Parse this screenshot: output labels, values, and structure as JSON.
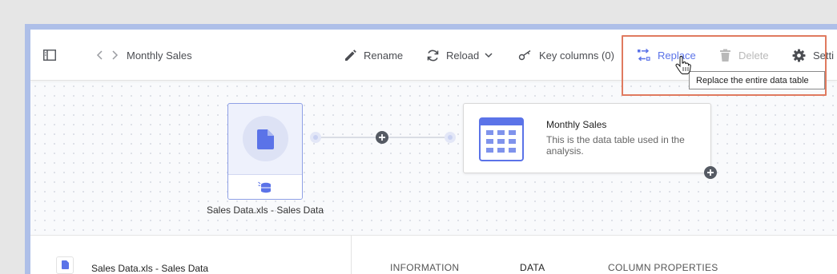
{
  "breadcrumb": {
    "title": "Monthly Sales"
  },
  "toolbar": {
    "rename_label": "Rename",
    "reload_label": "Reload",
    "key_columns_label": "Key columns (0)",
    "replace_label": "Replace",
    "delete_label": "Delete",
    "settings_label": "Setti"
  },
  "tooltip": {
    "text": "Replace the entire data table"
  },
  "source_node": {
    "label": "Sales Data.xls - Sales Data"
  },
  "table_node": {
    "title": "Monthly Sales",
    "description": "This is the data table used in the analysis."
  },
  "details": {
    "source_name": "Sales Data.xls - Sales Data",
    "tabs": [
      "INFORMATION",
      "DATA",
      "COLUMN PROPERTIES"
    ]
  },
  "colors": {
    "accent": "#5b73e8",
    "node_border": "#8fa0e6",
    "node_fill": "#eef1fc",
    "highlight": "#e07a5f",
    "disabled": "#b9b9b9"
  }
}
